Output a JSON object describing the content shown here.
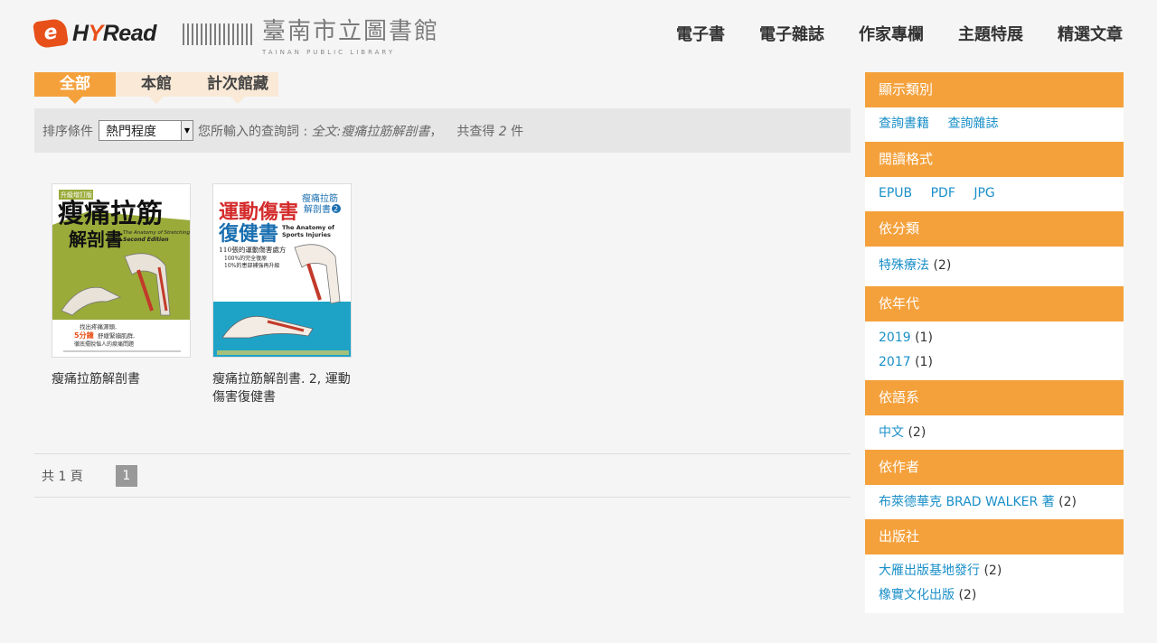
{
  "header": {
    "logo_text": "HyRead",
    "library_name_cn": "臺南市立圖書館",
    "library_name_en": "TAINAN PUBLIC LIBRARY",
    "nav": [
      "電子書",
      "電子雜誌",
      "作家專欄",
      "主題特展",
      "精選文章"
    ]
  },
  "tabs": [
    "全部",
    "本館",
    "計次館藏"
  ],
  "sortbar": {
    "label": "排序條件",
    "selected": "熱門程度",
    "query_label": "您所輸入的查詢詞 :",
    "query_text": "全文:瘦痛拉筋解剖書",
    "count_prefix": "共查得",
    "count": "2",
    "count_suffix": "件"
  },
  "books": [
    {
      "title": "瘦痛拉筋解剖書",
      "cover": {
        "badge": "升級增訂版",
        "main": "瘦痛拉筋",
        "sub": "解剖書",
        "en1": "The Anatomy of Stretching",
        "en2": "Second Edition",
        "tagline1": "找出疼痛源頭,",
        "tagline2": "5分鐘",
        "tagline3": "舒緩緊繃肌群,",
        "tagline4": "徹底擺脫惱人的痠痛問題"
      }
    },
    {
      "title": "瘦痛拉筋解剖書. 2, 運動傷害復健書",
      "cover": {
        "series": "瘦痛拉筋",
        "series2": "解剖書",
        "num": "2",
        "main1": "運動傷害",
        "main2": "復健書",
        "en1": "The Anatomy of",
        "en2": "Sports Injuries",
        "line1": "110張的運動傷害處方",
        "line2": "100%的完全復原",
        "line3": "10%的患部補強再升級"
      }
    }
  ],
  "pager": {
    "label": "共 1 頁",
    "current": "1"
  },
  "sidebar": {
    "show_type": {
      "title": "顯示類別",
      "items": [
        "查詢書籍",
        "查詢雜誌"
      ]
    },
    "format": {
      "title": "閱讀格式",
      "items": [
        "EPUB",
        "PDF",
        "JPG"
      ]
    },
    "category": {
      "title": "依分類",
      "items": [
        {
          "label": "特殊療法",
          "count": "(2)"
        }
      ]
    },
    "year": {
      "title": "依年代",
      "items": [
        {
          "label": "2019",
          "count": "(1)"
        },
        {
          "label": "2017",
          "count": "(1)"
        }
      ]
    },
    "language": {
      "title": "依語系",
      "items": [
        {
          "label": "中文",
          "count": "(2)"
        }
      ]
    },
    "author": {
      "title": "依作者",
      "items": [
        {
          "label": "布萊德華克 BRAD WALKER 著",
          "count": "(2)"
        }
      ]
    },
    "publisher": {
      "title": "出版社",
      "items": [
        {
          "label": "大雁出版基地發行",
          "count": "(2)"
        },
        {
          "label": "橡實文化出版",
          "count": "(2)"
        }
      ]
    }
  },
  "colors": {
    "accent": "#f4a13c",
    "link": "#1a8fc8",
    "tab_inactive": "#f9e9d6"
  }
}
